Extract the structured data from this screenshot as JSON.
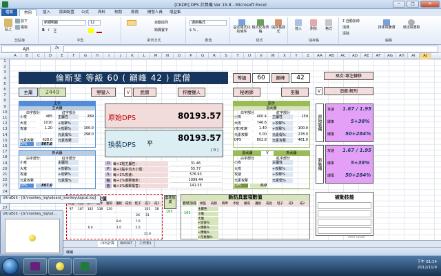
{
  "window": {
    "title": "[CKDR] DPS 計算機 Ver 15.8 - Microsoft Excel",
    "minimize": "─",
    "maximize": "□",
    "close": "✕"
  },
  "ribbon": {
    "tabs": [
      "檔案",
      "常用",
      "插入",
      "版面配置",
      "公式",
      "資料",
      "校閱",
      "檢視",
      "開發人員",
      "增益集"
    ],
    "active_tab": "常用",
    "clipboard": {
      "paste": "貼上",
      "cut": "剪下",
      "copy": "複製",
      "label": "剪貼簿"
    },
    "font": {
      "name": "新細明體",
      "size": "12",
      "label": "字型"
    },
    "alignment": {
      "wrap": "自動換列",
      "merge": "跨欄置中",
      "label": "對齊方式"
    },
    "number": {
      "format": "通用格式",
      "label": "數值"
    },
    "styles": {
      "cond": "設定格式化的條件",
      "table": "格式化為表格",
      "cell": "儲存格樣式",
      "label": "樣式"
    },
    "cells": {
      "insert": "插入",
      "delete": "刪除",
      "format": "格式",
      "label": "儲存格"
    },
    "editing": {
      "autosum": "自動加總",
      "fill": "填滿",
      "clear": "清除",
      "sort": "排序與篩選",
      "find": "尋找與選取",
      "label": "編輯"
    }
  },
  "formula_bar": {
    "name_box": "AJ5",
    "fx": "fx",
    "content": ""
  },
  "columns": [
    "A",
    "B",
    "C",
    "D",
    "E",
    "F",
    "G",
    "H",
    "I",
    "J",
    "K",
    "L",
    "M",
    "N",
    "O",
    "P",
    "Q",
    "R",
    "S",
    "T",
    "U",
    "V",
    "W",
    "X",
    "Y",
    "Z",
    "AA",
    "AB",
    "AC",
    "AD",
    "AE",
    "AF",
    "AG",
    "AH",
    "AI",
    "AJ"
  ],
  "selected_column": "AJ",
  "rows": [
    "1",
    "2",
    "3",
    "4",
    "5",
    "6",
    "7",
    "8",
    "9",
    "10",
    "11",
    "12",
    "13",
    "14",
    "15",
    "16",
    "17",
    "18",
    "19",
    "20",
    "21",
    "22",
    "23",
    "24",
    "25",
    "26",
    "27",
    "28",
    "29",
    "30",
    "31",
    "32"
  ],
  "sheet": {
    "banner": "倫斯斐 等級 60 ( 巔峰 42 ) 武僧",
    "level_label": "等級",
    "level_value": "60",
    "paragon_label": "巔峰",
    "paragon_value": "42",
    "main_attr_label": "主屬",
    "main_attr_value": "2449",
    "classes": [
      "野蠻人",
      "V",
      "武僧",
      "狩魔獵人",
      "秘術師",
      "巫醫"
    ],
    "right_tags": [
      "巫女:專注轉移",
      "迴避:解刑"
    ],
    "right_v": "V",
    "main_hand": {
      "title": "主手",
      "weapon": "主武器",
      "white": "白字部分",
      "red": "紅字部分",
      "rows": [
        [
          "小攻",
          "485",
          "主屬性",
          "289"
        ],
        [
          "大攻",
          "1010",
          "+攻擊%",
          ""
        ],
        [
          "攻速",
          "1.20",
          "+攻擊%",
          "100.0"
        ],
        [
          "",
          "",
          "元素傷%",
          "298.0"
        ],
        [
          "元素攻擊",
          "628.0",
          "元素攻擊",
          ""
        ]
      ],
      "dps_label": "DPS",
      "dps_value": "897.0"
    },
    "off_hand": {
      "title": "副手",
      "weapon": "副武器",
      "white": "白字部分",
      "red": "紅字部分",
      "rows": [
        [
          "小攻",
          "400.4",
          "主屬性",
          "159"
        ],
        [
          "大攻",
          "746.6",
          "+攻擊%",
          ""
        ],
        [
          "(攻)攻速",
          "1.40",
          "+攻擊%",
          "100.0"
        ],
        [
          "元素攻擊",
          "5.00",
          "元素傷%",
          "278.0"
        ],
        [
          "DPS",
          "802.8",
          "元素攻擊",
          "461.0"
        ]
      ]
    },
    "dps_origin_label": "原始DPS",
    "dps_origin_value": "80193.57",
    "dps_swap_label": "換裝DPS",
    "dps_swap_mark": "平",
    "dps_swap_value": "80193.57",
    "dps_diff": "( 0 )",
    "swap_main": {
      "title": "新武器",
      "white": "白字部分",
      "red": "紅字部分",
      "rows": [
        [
          "小攻",
          "",
          "主屬性",
          ""
        ],
        [
          "大攻",
          "",
          "+攻擊%",
          ""
        ],
        [
          "攻速",
          "",
          "+攻擊%",
          ""
        ],
        [
          "元素攻擊",
          "",
          "元素傷%",
          ""
        ]
      ],
      "dps_label": "DPS",
      "dps_value": "897.0"
    },
    "swap_off": {
      "title": "副武器",
      "v": "V",
      "weapon": "新武器",
      "white": "白字部分",
      "red": "紅字部分",
      "rows": [
        [
          "小攻",
          "",
          "主屬性",
          ""
        ],
        [
          "大攻",
          "",
          "+攻擊%",
          ""
        ],
        [
          "攻速",
          "",
          "+攻擊%",
          ""
        ],
        [
          "元素攻擊",
          "",
          "元素傷%",
          ""
        ]
      ],
      "dps_label": "DPS",
      "dps_value": "0.0"
    },
    "dps_side_letters": [
      "D",
      "P",
      "S",
      "每",
      "值"
    ],
    "dps_per": [
      [
        "每+1點主屬性：",
        "31.46"
      ],
      [
        "每+1點平均大小傷：",
        "55.77"
      ],
      [
        "每+1%攻速：",
        "576.93"
      ],
      [
        "每+1%爆擊機率：",
        "1099.44"
      ],
      [
        "每+1%爆擊傷害：",
        "141.55"
      ]
    ],
    "orig_side": "原始裝備",
    "new_side": "新裝備",
    "orig_stats": [
      [
        "攻速",
        "1.67 / 1.95"
      ],
      [
        "爆率",
        "5+38%"
      ],
      [
        "爆傷",
        "50+284%"
      ]
    ],
    "new_stats": [
      [
        "攻速",
        "1.67 / 1.95"
      ],
      [
        "爆率",
        "5+38%"
      ],
      [
        "爆傷",
        "50+284%"
      ]
    ],
    "passive_title": "被動技能",
    "armor_title": "護具數值",
    "armor_header": [
      "頭盔",
      "肩膀",
      "胸甲",
      "護手",
      "腰帶",
      "護腕",
      "戒指",
      "鞋子",
      "戒1",
      "戒2"
    ],
    "armor_rows": [
      [
        "97",
        "187",
        "182",
        "138",
        "120",
        "",
        "",
        "",
        "163",
        "58"
      ],
      [
        "",
        "",
        "",
        "",
        "",
        "",
        "",
        "26",
        "31",
        ""
      ],
      [
        "",
        "",
        "",
        "",
        "",
        "8.0",
        "",
        "7.0",
        "",
        ""
      ],
      [
        "",
        "",
        "6.0",
        "",
        "",
        "1.0",
        "",
        "5.0",
        "",
        ""
      ],
      [
        "",
        "",
        "",
        "",
        "",
        "",
        "",
        "",
        "31.0",
        ""
      ]
    ],
    "total_title": "套裝加成",
    "total_val": "165",
    "new_armor_title": "新防具套項數值",
    "new_armor_header": [
      "頭盔",
      "肩膀",
      "胸甲",
      "手套",
      "腰帶",
      "護腕",
      "戒指",
      "鞋子",
      "戒1",
      "戒2"
    ],
    "new_armor_left_title": "套裝加成",
    "new_armor_left_val": "165",
    "new_armor_attrs": [
      "主屬性",
      "小傷",
      "大傷",
      "+攻速%",
      "+爆擊%",
      "+爆傷%",
      "+元素傷%"
    ],
    "credit": "Inter Chow",
    "sheet_tabs": [
      "DPS計算",
      "INPORT",
      "工作表1"
    ],
    "status_ready": "就緒"
  },
  "popups": {
    "ultraedit_bar": "UltraEdit - [G:\\monkey_log\\sdoard_monkey\\logcat.log]",
    "ultraedit_thumb": "UltraEdit - [G:\\monkey_log\\sd..."
  },
  "taskbar": {
    "time": "下午 01:14",
    "date": "2012/11/9"
  }
}
